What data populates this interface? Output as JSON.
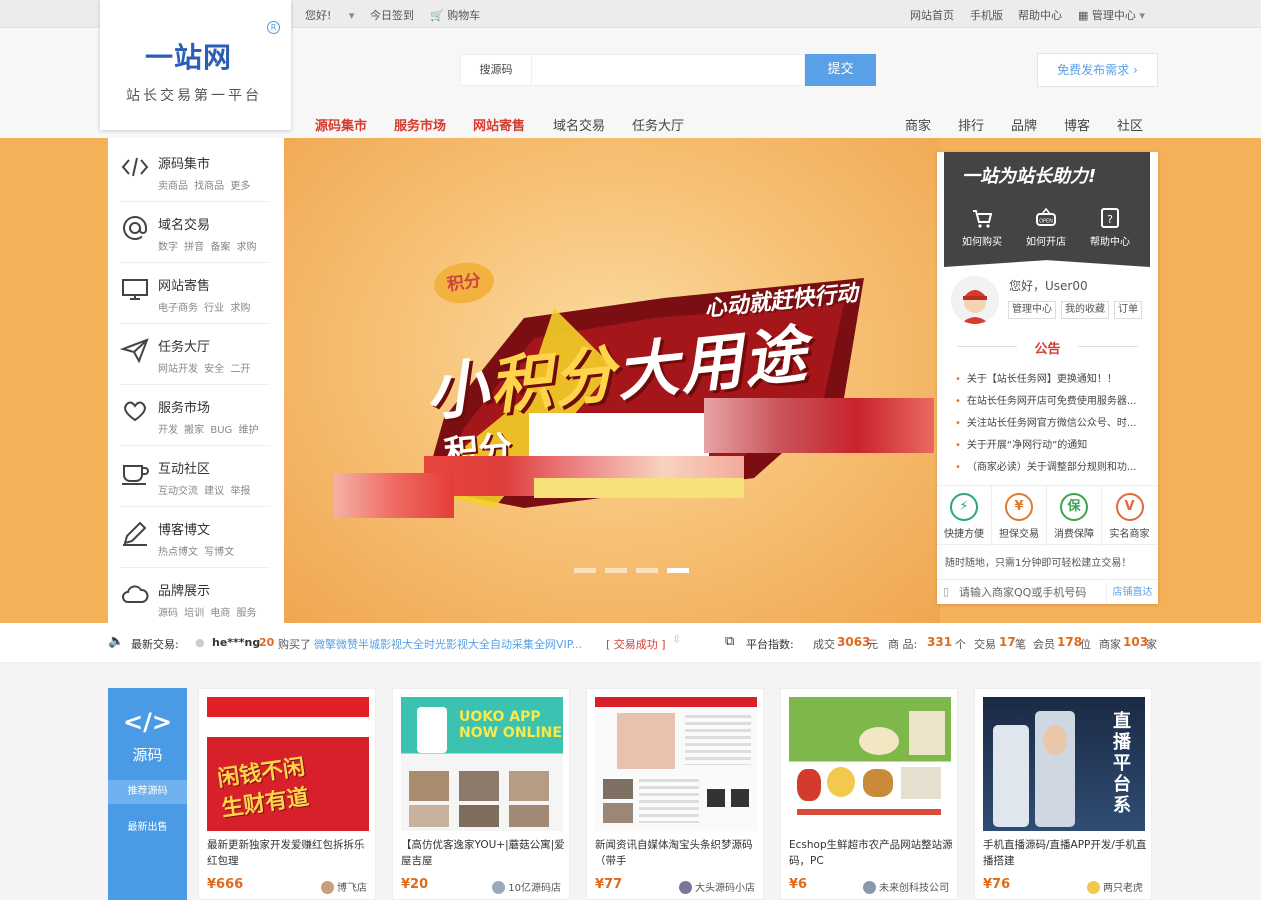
{
  "topbar": {
    "greeting": "您好!",
    "checkin": "今日签到",
    "cart": "购物车",
    "home": "网站首页",
    "mobile": "手机版",
    "help": "帮助中心",
    "admin": "管理中心"
  },
  "logo": {
    "main": "一站网",
    "sub": "站长交易第一平台",
    "reg": "R"
  },
  "search": {
    "label": "搜源码",
    "placeholder": "",
    "button": "提交"
  },
  "publish": "免费发布需求",
  "nav": {
    "main": [
      "源码集市",
      "服务市场",
      "网站寄售",
      "域名交易",
      "任务大厅"
    ],
    "right": [
      "商家",
      "排行",
      "品牌",
      "博客",
      "社区"
    ]
  },
  "sidemenu": [
    {
      "title": "源码集市",
      "sub": "卖商品 找商品 更多",
      "icon": "code-icon"
    },
    {
      "title": "域名交易",
      "sub": "数字 拼音 备案 求购",
      "icon": "at-icon"
    },
    {
      "title": "网站寄售",
      "sub": "电子商务 行业 求购",
      "icon": "monitor-icon"
    },
    {
      "title": "任务大厅",
      "sub": "网站开发 安全 二开",
      "icon": "send-icon"
    },
    {
      "title": "服务市场",
      "sub": "开发 搬家 BUG 维护",
      "icon": "heart-hand-icon"
    },
    {
      "title": "互动社区",
      "sub": "互动交流 建议 举报",
      "icon": "cup-icon"
    },
    {
      "title": "博客博文",
      "sub": "热点博文 写博文",
      "icon": "pen-icon"
    },
    {
      "title": "品牌展示",
      "sub": "源码 培训 电商 服务",
      "icon": "cloud-icon"
    }
  ],
  "banner": {
    "badge": "积分",
    "slogan_small": "心动就赶快行动",
    "slogan_big_a": "小",
    "slogan_big_b": "积分",
    "slogan_big_c": "大用途",
    "slogan_line3": "积分"
  },
  "panel": {
    "title": "一站为站长助力!",
    "links": [
      "如何购买",
      "如何开店",
      "帮助中心"
    ],
    "greeting": "您好，User00",
    "tags": [
      "管理中心",
      "我的收藏",
      "订单"
    ],
    "notice_title": "公告",
    "notices": [
      "关于【站长任务网】更换通知！！",
      "在站长任务网开店可免费使用服务器...",
      "关注站长任务网官方微信公众号、时...",
      "关于开展“净网行动”的通知",
      "（商家必读）关于调整部分规则和功..."
    ],
    "badges": [
      {
        "icon": "⚡",
        "label": "快捷方便",
        "color": "#2aa87a"
      },
      {
        "icon": "¥",
        "label": "担保交易",
        "color": "#e07a2e"
      },
      {
        "icon": "保",
        "label": "消费保障",
        "color": "#3aa650"
      },
      {
        "icon": "V",
        "label": "实名商家",
        "color": "#e06a3a"
      }
    ],
    "slogan": "随时随地，只需1分钟即可轻松建立交易！",
    "qq_placeholder": "请输入商家QQ或手机号码",
    "qq_button": "店铺直达"
  },
  "ticker": {
    "label": "最新交易:",
    "user": "he***ng",
    "num": "20",
    "bought": "购买了",
    "item": "微擎微赞半城影视大全时光影视大全自动采集全网VIP...",
    "status": "[ 交易成功 ]",
    "index_label": "平台指数:",
    "deals_label": "成交",
    "deals": "3063",
    "deals_unit": "元",
    "goods_label": "商 品:",
    "goods": "331",
    "goods_unit": "个",
    "trade_label": "交易",
    "trade": "17",
    "trade_unit": "笔",
    "member_label": "会员",
    "member": "178",
    "member_unit": "位",
    "shop_label": "商家",
    "shop": "103",
    "shop_unit": "家"
  },
  "products": {
    "category": {
      "icon": "</>",
      "label": "源码",
      "tab1": "推荐源码",
      "tab2": "最新出售"
    },
    "items": [
      {
        "title": "最新更新独家开发爱赚红包拆拆乐红包理",
        "price": "¥666",
        "shop": "博飞店"
      },
      {
        "title": "【高仿优客逸家YOU+|蘑菇公寓|爱屋吉屋",
        "price": "¥20",
        "shop": "10亿源码店"
      },
      {
        "title": "新闻资讯自媒体淘宝头条织梦源码（带手",
        "price": "¥77",
        "shop": "大头源码小店"
      },
      {
        "title": "Ecshop生鲜超市农产品网站整站源码，PC",
        "price": "¥6",
        "shop": "未来创科技公司"
      },
      {
        "title": "手机直播源码/直播APP开发/手机直播搭建",
        "price": "¥76",
        "shop": "两只老虎"
      }
    ]
  },
  "card_images": {
    "img3_text": "UOKO APP NOW ONLINE",
    "img5_text": "直播平台系"
  },
  "colors": {
    "accent": "#5aa0e6",
    "hot": "#d63b2f",
    "banner": "#f5b158",
    "price": "#e06a1a"
  }
}
